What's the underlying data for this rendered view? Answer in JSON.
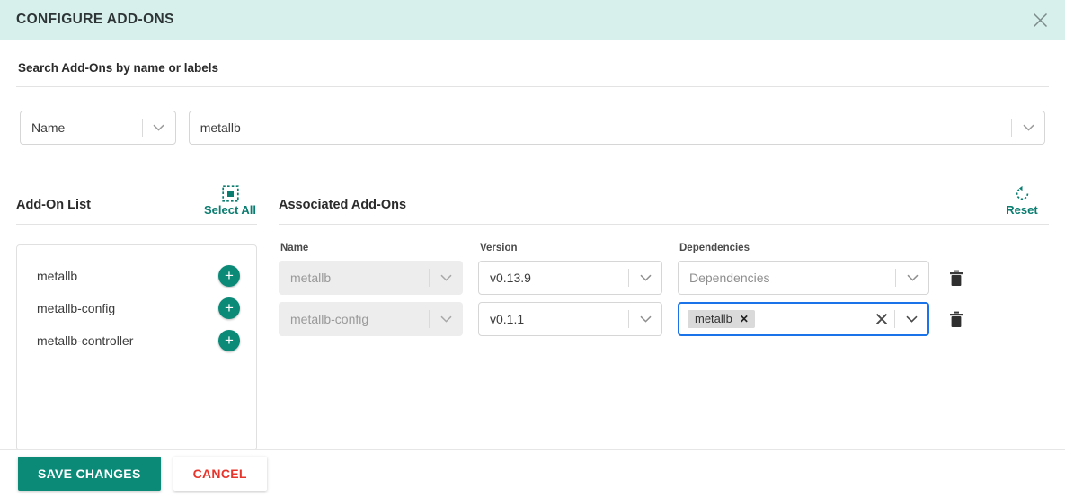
{
  "dialog": {
    "title": "CONFIGURE ADD-ONS",
    "close_icon": "close-icon",
    "header_bg": "#d8f0ec"
  },
  "search": {
    "heading": "Search Add-Ons by name or labels",
    "type_select": {
      "value": "Name",
      "chevron_icon": "chevron-down-icon"
    },
    "query_input": {
      "value": "metallb",
      "placeholder": "",
      "chevron_icon": "chevron-down-icon"
    }
  },
  "addon_list": {
    "title": "Add-On List",
    "select_all": {
      "label": "Select All",
      "icon": "select-all-icon",
      "color": "#0b7d70"
    },
    "items": [
      {
        "name": "metallb",
        "add_icon": "plus-icon"
      },
      {
        "name": "metallb-config",
        "add_icon": "plus-icon"
      },
      {
        "name": "metallb-controller",
        "add_icon": "plus-icon"
      }
    ]
  },
  "associated": {
    "title": "Associated Add-Ons",
    "reset": {
      "label": "Reset",
      "icon": "reset-icon",
      "color": "#0b7d70"
    },
    "columns": [
      "Name",
      "Version",
      "Dependencies"
    ],
    "rows": [
      {
        "name": "metallb",
        "name_disabled": true,
        "version": "v0.13.9",
        "dependencies_placeholder": "Dependencies",
        "dependencies": [],
        "focused": false,
        "delete_icon": "trash-icon"
      },
      {
        "name": "metallb-config",
        "name_disabled": true,
        "version": "v0.1.1",
        "dependencies_placeholder": "",
        "dependencies": [
          "metallb"
        ],
        "focused": true,
        "delete_icon": "trash-icon"
      }
    ]
  },
  "footer": {
    "save_label": "SAVE CHANGES",
    "cancel_label": "CANCEL",
    "save_color": "#0b8a78",
    "cancel_color": "#e8342b"
  }
}
